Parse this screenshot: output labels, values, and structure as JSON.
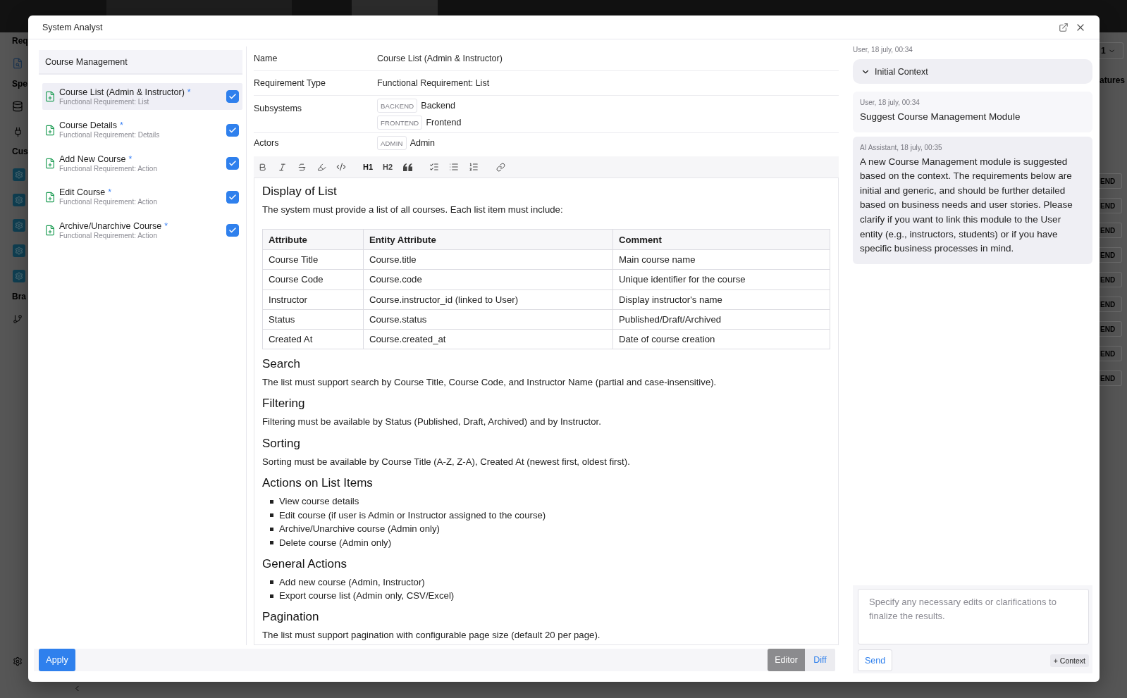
{
  "backdrop": {
    "sidebar_labels": [
      "Req",
      "Spe",
      "Cus",
      "Bra"
    ],
    "dropdown_value": "1",
    "label": "atures",
    "tags": [
      "END",
      "END",
      "END",
      "END",
      "END",
      "END",
      "END",
      "END",
      "END"
    ]
  },
  "dialog": {
    "title": "System Analyst"
  },
  "requirements_panel": {
    "group": "Course Management",
    "items": [
      {
        "title": "Course List (Admin & Instructor)",
        "marker": "*",
        "subtitle": "Functional Requirement: List",
        "selected": true,
        "checked": true
      },
      {
        "title": "Course Details",
        "marker": "*",
        "subtitle": "Functional Requirement: Details",
        "selected": false,
        "checked": true
      },
      {
        "title": "Add New Course",
        "marker": "*",
        "subtitle": "Functional Requirement: Action",
        "selected": false,
        "checked": true
      },
      {
        "title": "Edit Course",
        "marker": "*",
        "subtitle": "Functional Requirement: Action",
        "selected": false,
        "checked": true
      },
      {
        "title": "Archive/Unarchive Course",
        "marker": "*",
        "subtitle": "Functional Requirement: Action",
        "selected": false,
        "checked": true
      }
    ]
  },
  "details": {
    "fields": [
      {
        "kind": "text",
        "label": "Name",
        "value": "Course List (Admin & Instructor)"
      },
      {
        "kind": "text",
        "label": "Requirement Type",
        "value": "Functional Requirement: List"
      },
      {
        "kind": "tags",
        "label": "Subsystems",
        "tags": [
          {
            "code": "BACKEND",
            "name": "Backend"
          },
          {
            "code": "FRONTEND",
            "name": "Frontend"
          }
        ]
      },
      {
        "kind": "tags",
        "label": "Actors",
        "tags": [
          {
            "code": "ADMIN",
            "name": "Admin"
          }
        ]
      }
    ]
  },
  "editor": {
    "toolbar": {
      "headings": [
        "H1",
        "H2"
      ]
    },
    "blocks": [
      {
        "kind": "heading",
        "text": "Display of List"
      },
      {
        "kind": "paragraph",
        "text": "The system must provide a list of all courses. Each list item must include:"
      },
      {
        "kind": "table",
        "columns": [
          "Attribute",
          "Entity Attribute",
          "Comment"
        ],
        "rows": [
          [
            "Course Title",
            "Course.title",
            "Main course name"
          ],
          [
            "Course Code",
            "Course.code",
            "Unique identifier for the course"
          ],
          [
            "Instructor",
            "Course.instructor_id (linked to User)",
            "Display instructor's name"
          ],
          [
            "Status",
            "Course.status",
            "Published/Draft/Archived"
          ],
          [
            "Created At",
            "Course.created_at",
            "Date of course creation"
          ]
        ]
      },
      {
        "kind": "heading",
        "text": "Search"
      },
      {
        "kind": "paragraph",
        "text": "The list must support search by Course Title, Course Code, and Instructor Name (partial and case-insensitive)."
      },
      {
        "kind": "heading",
        "text": "Filtering"
      },
      {
        "kind": "paragraph",
        "text": "Filtering must be available by Status (Published, Draft, Archived) and by Instructor."
      },
      {
        "kind": "heading",
        "text": "Sorting"
      },
      {
        "kind": "paragraph",
        "text": "Sorting must be available by Course Title (A-Z, Z-A), Created At (newest first, oldest first)."
      },
      {
        "kind": "heading",
        "text": "Actions on List Items"
      },
      {
        "kind": "list",
        "items": [
          "View course details",
          "Edit course (if user is Admin or Instructor assigned to the course)",
          "Archive/Unarchive course (Admin only)",
          "Delete course (Admin only)"
        ]
      },
      {
        "kind": "heading",
        "text": "General Actions"
      },
      {
        "kind": "list",
        "items": [
          "Add new course (Admin, Instructor)",
          "Export course list (Admin only, CSV/Excel)"
        ]
      },
      {
        "kind": "heading",
        "text": "Pagination"
      },
      {
        "kind": "paragraph",
        "text": "The list must support pagination with configurable page size (default 20 per page)."
      }
    ]
  },
  "footer": {
    "apply": "Apply",
    "view_modes": [
      {
        "label": "Editor",
        "selected": true
      },
      {
        "label": "Diff",
        "selected": false
      }
    ]
  },
  "chat": {
    "context": {
      "meta": "User, 18 july, 00:34",
      "label": "Initial Context",
      "expanded": false
    },
    "messages": [
      {
        "kind": "user",
        "meta": "User, 18 july, 00:34",
        "text": "Suggest Course Management Module"
      },
      {
        "kind": "assistant",
        "meta": "AI Assistant, 18 july, 00:35",
        "text": "A new Course Management module is suggested based on the context. The requirements below are initial and generic, and should be further detailed based on business needs and user stories. Please clarify if you want to link this module to the User entity (e.g., instructors, students) or if you have specific business processes in mind."
      }
    ],
    "composer": {
      "placeholder": "Specify any necessary edits or clarifications to finalize the results.",
      "send": "Send",
      "add_context": "+ Context"
    }
  }
}
